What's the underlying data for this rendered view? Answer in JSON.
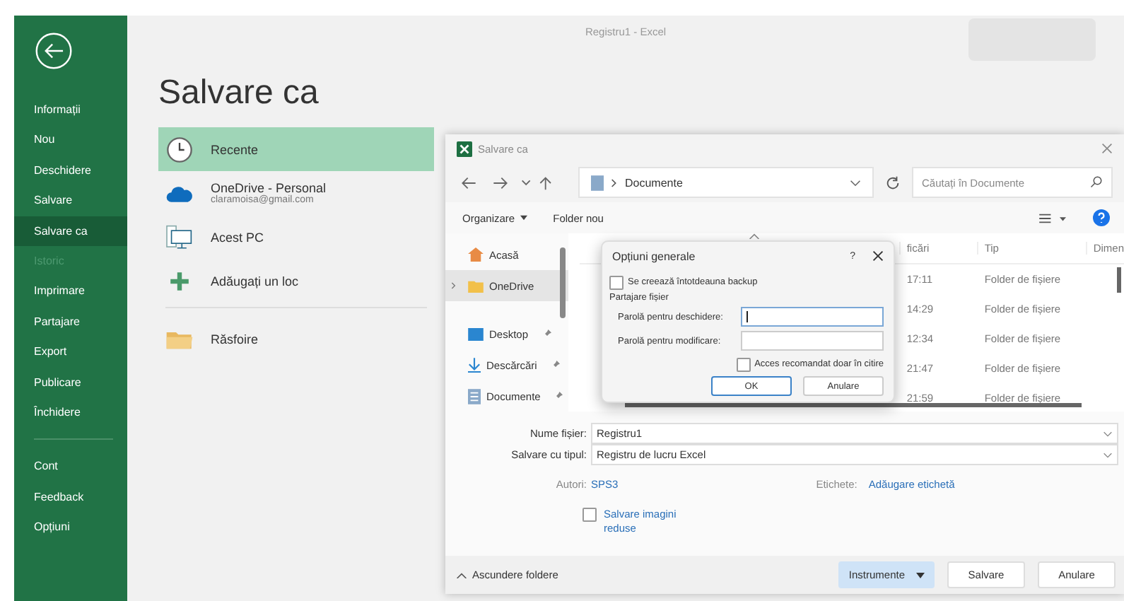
{
  "window": {
    "title": "Registru1 - Excel"
  },
  "sidebar": {
    "items": [
      {
        "label": "Informații",
        "selected": false,
        "disabled": false
      },
      {
        "label": "Nou",
        "selected": false,
        "disabled": false
      },
      {
        "label": "Deschidere",
        "selected": false,
        "disabled": false
      },
      {
        "label": "Salvare",
        "selected": false,
        "disabled": false
      },
      {
        "label": "Salvare ca",
        "selected": true,
        "disabled": false
      },
      {
        "label": "Istoric",
        "selected": false,
        "disabled": true
      },
      {
        "label": "Imprimare",
        "selected": false,
        "disabled": false
      },
      {
        "label": "Partajare",
        "selected": false,
        "disabled": false
      },
      {
        "label": "Export",
        "selected": false,
        "disabled": false
      },
      {
        "label": "Publicare",
        "selected": false,
        "disabled": false
      },
      {
        "label": "Închidere",
        "selected": false,
        "disabled": false
      }
    ],
    "bottom_items": [
      {
        "label": "Cont",
        "selected": false
      },
      {
        "label": "Feedback",
        "selected": false
      },
      {
        "label": "Opțiuni",
        "selected": false
      }
    ]
  },
  "page_title": "Salvare ca",
  "locations": [
    {
      "kind": "recent",
      "label": "Recente",
      "selected": true
    },
    {
      "kind": "onedrive",
      "label": "OneDrive - Personal",
      "sublabel": "claramoisa@gmail.com",
      "selected": false
    },
    {
      "kind": "pc",
      "label": "Acest PC",
      "selected": false
    },
    {
      "kind": "add",
      "label": "Adăugați un loc",
      "selected": false
    }
  ],
  "browse": {
    "label": "Răsfoire"
  },
  "save_dialog": {
    "title": "Salvare ca",
    "path": "Documente",
    "search": {
      "placeholder": "Căutați în Documente"
    },
    "toolbar": [
      {
        "label": "Organizare",
        "dropdown": true
      },
      {
        "label": "Folder nou",
        "dropdown": false
      }
    ],
    "nav": [
      {
        "kind": "home",
        "label": "Acasă",
        "selected": false,
        "expandable": false,
        "pinned": false
      },
      {
        "kind": "cloud",
        "label": "OneDrive",
        "selected": true,
        "expandable": true,
        "pinned": false
      },
      {
        "kind": "desktop",
        "label": "Desktop",
        "selected": false,
        "expandable": false,
        "pinned": true
      },
      {
        "kind": "downloads",
        "label": "Descărcări",
        "selected": false,
        "expandable": false,
        "pinned": true
      },
      {
        "kind": "documents",
        "label": "Documente",
        "selected": false,
        "expandable": false,
        "pinned": true
      }
    ],
    "columns": [
      "ficări",
      "Tip",
      "Dimen"
    ],
    "rows": [
      {
        "time": "17:11",
        "type": "Folder de fișiere"
      },
      {
        "time": "14:29",
        "type": "Folder de fișiere"
      },
      {
        "time": "12:34",
        "type": "Folder de fișiere"
      },
      {
        "time": "21:47",
        "type": "Folder de fișiere"
      },
      {
        "time": "21:59",
        "type": "Folder de fișiere"
      }
    ],
    "file_name": {
      "label": "Nume fișier:",
      "value": "Registru1"
    },
    "file_type": {
      "label": "Salvare cu tipul:",
      "value": "Registru de lucru Excel"
    },
    "authors": {
      "label": "Autori:",
      "value": "SPS3"
    },
    "tags": {
      "label": "Etichete:",
      "value": "Adăugare etichetă"
    },
    "thumbnail": {
      "label": "Salvare imagini reduse",
      "checked": false
    },
    "hide_folders": "Ascundere foldere",
    "buttons": [
      {
        "kind": "menu",
        "label": "Instrumente"
      },
      {
        "kind": "primary",
        "label": "Salvare"
      },
      {
        "kind": "plain",
        "label": "Anulare"
      }
    ]
  },
  "options_dialog": {
    "title": "Opțiuni generale",
    "help": "?",
    "backup": {
      "label": "Se creează întotdeauna backup",
      "checked": false
    },
    "section": "Partajare fișier",
    "passwords": [
      {
        "label": "Parolă pentru deschidere:",
        "focused": true
      },
      {
        "label": "Parolă pentru modificare:",
        "focused": false
      }
    ],
    "read_only": {
      "label": "Acces recomandat doar în citire",
      "checked": false
    },
    "buttons": [
      {
        "label": "OK",
        "default": true
      },
      {
        "label": "Anulare",
        "default": false
      }
    ]
  }
}
